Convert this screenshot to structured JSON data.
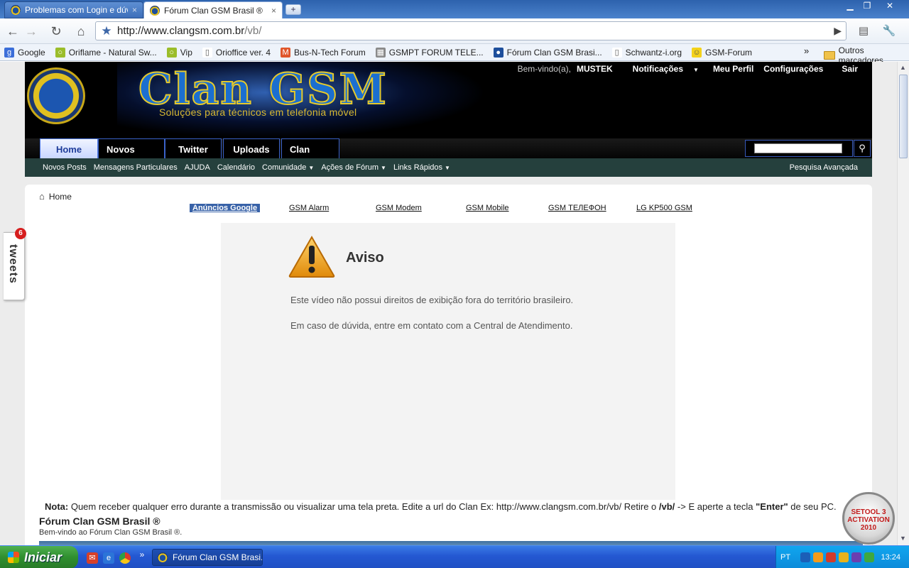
{
  "browser": {
    "tabs": [
      {
        "title": "Problemas com Login e dúvi...",
        "close": "×"
      },
      {
        "title": "Fórum Clan GSM Brasil ®",
        "close": "×"
      }
    ],
    "newtab_symbol": "+",
    "url_host": "http://www.clangsm.com.br",
    "url_path": "/vb/",
    "bookmarks": [
      {
        "label": "Google",
        "icon": "google-icon",
        "color": "#3b6ed9",
        "glyph": "g"
      },
      {
        "label": "Oriflame - Natural Sw...",
        "icon": "ring-icon",
        "color": "#9bbd2a",
        "glyph": "○"
      },
      {
        "label": "Vip",
        "icon": "ring-icon",
        "color": "#9bbd2a",
        "glyph": "○"
      },
      {
        "label": "Orioffice ver. 4",
        "icon": "page-icon",
        "color": "#ffffff",
        "glyph": "▯"
      },
      {
        "label": "Bus-N-Tech Forum",
        "icon": "magento-icon",
        "color": "#e0562a",
        "glyph": "M"
      },
      {
        "label": "GSMPT FORUM TELE...",
        "icon": "forum-icon",
        "color": "#8a8a8a",
        "glyph": "▦"
      },
      {
        "label": "Fórum Clan GSM Brasi...",
        "icon": "clangsm-icon",
        "color": "#1e4f9c",
        "glyph": "●"
      },
      {
        "label": "Schwantz-i.org",
        "icon": "page-icon",
        "color": "#ffffff",
        "glyph": "▯"
      },
      {
        "label": "GSM-Forum",
        "icon": "smiley-icon",
        "color": "#f4d21a",
        "glyph": "☺"
      }
    ],
    "bookmarks_more": "»",
    "other_bookmarks": "Outros marcadores"
  },
  "site": {
    "brand": "Clan GSM",
    "tagline": "Soluções para técnicos em telefonia móvel",
    "welcome": "Bem-vindo(a),",
    "username": "MUSTEK",
    "user_links": [
      "Notificações",
      "Meu Perfil",
      "Configurações",
      "Sair"
    ],
    "nav_tabs": [
      "Home",
      "Novos Posts",
      "Twitter",
      "Uploads",
      "Clan SHOP"
    ],
    "sub_links": [
      "Novos Posts",
      "Mensagens Particulares",
      "AJUDA",
      "Calendário",
      "Comunidade",
      "Ações de Fórum",
      "Links Rápidos"
    ],
    "advanced_search": "Pesquisa Avançada",
    "search_icon": "magnifier-icon",
    "breadcrumb": "Home",
    "ad_links": [
      "Anúncios Google",
      "GSM Alarm",
      "GSM Modem",
      "GSM Mobile",
      "GSM ТЕЛЕФОН",
      "LG KP500 GSM"
    ],
    "player": {
      "title": "Aviso",
      "line1": "Este vídeo não possui direitos de exibição fora do território brasileiro.",
      "line2": "Em caso de dúvida, entre em contato com a Central de Atendimento."
    },
    "nota_label": "Nota:",
    "nota_text": " Quem receber qualquer erro durante a transmissão ou visualizar uma tela preta. Edite a url do Clan Ex: http://www.clangsm.com.br/vb/ Retire o ",
    "nota_vb": "/vb/",
    "nota_text2": " -> E aperte a tecla ",
    "nota_enter": "\"Enter\"",
    "nota_text3": " de seu PC.",
    "forum_title": "Fórum Clan GSM Brasil ®",
    "forum_sub": "Bem-vindo ao Fórum Clan GSM Brasil ®.",
    "tweets_label": "tweets",
    "tweets_count": "6",
    "setool_badge": [
      "SETOOL 3",
      "ACTIVATION",
      "2010"
    ]
  },
  "taskbar": {
    "start": "Iniciar",
    "window": "Fórum Clan GSM Brasi...",
    "lang": "PT",
    "clock": "13:24"
  }
}
